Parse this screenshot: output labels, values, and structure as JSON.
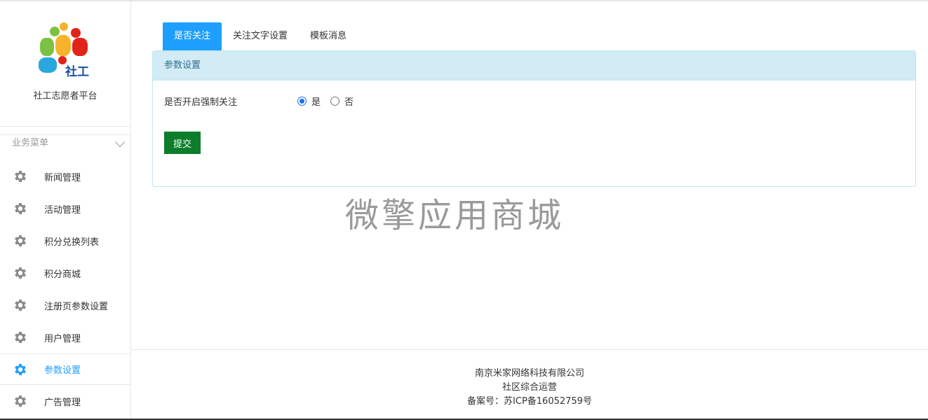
{
  "brand": {
    "logo_text": "社工",
    "name": "社工志愿者平台"
  },
  "menu": {
    "header": "业务菜单",
    "items": [
      {
        "label": "新闻管理",
        "icon": "gear-icon",
        "active": false
      },
      {
        "label": "活动管理",
        "icon": "gear-icon",
        "active": false
      },
      {
        "label": "积分兑换列表",
        "icon": "gear-icon",
        "active": false
      },
      {
        "label": "积分商城",
        "icon": "gear-icon",
        "active": false
      },
      {
        "label": "注册页参数设置",
        "icon": "gear-icon",
        "active": false
      },
      {
        "label": "用户管理",
        "icon": "gear-icon",
        "active": false
      },
      {
        "label": "参数设置",
        "icon": "gear-icon",
        "active": true
      },
      {
        "label": "广告管理",
        "icon": "gear-icon",
        "active": false
      }
    ]
  },
  "tabs": [
    {
      "label": "是否关注",
      "active": true
    },
    {
      "label": "关注文字设置",
      "active": false
    },
    {
      "label": "模板消息",
      "active": false
    }
  ],
  "panel": {
    "title": "参数设置",
    "field_label": "是否开启强制关注",
    "options": [
      {
        "label": "是",
        "checked": true
      },
      {
        "label": "否",
        "checked": false
      }
    ],
    "submit_label": "提交"
  },
  "watermark": "微擎应用商城",
  "footer": {
    "company": "南京米家网络科技有限公司",
    "tagline": "社区综合运营",
    "icp": "备案号：苏ICP备16052759号"
  },
  "colors": {
    "accent": "#1e9fff",
    "gear_default": "#8a8a8a",
    "submit_bg": "#0b7d2b",
    "panel_head_bg": "#d2ebf5"
  }
}
